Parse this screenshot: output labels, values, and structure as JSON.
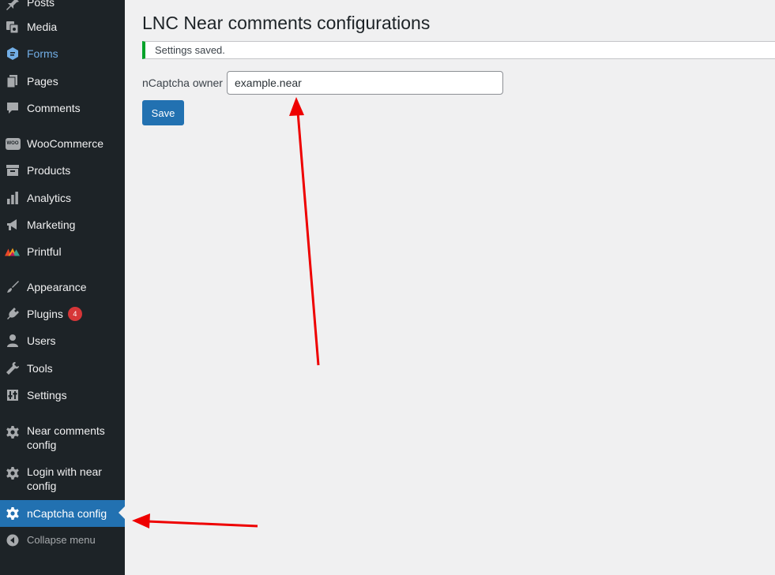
{
  "sidebar": {
    "items": [
      {
        "label": "Posts",
        "icon": "pin-icon"
      },
      {
        "label": "Media",
        "icon": "media-icon"
      },
      {
        "label": "Forms",
        "icon": "forms-icon"
      },
      {
        "label": "Pages",
        "icon": "pages-icon"
      },
      {
        "label": "Comments",
        "icon": "comment-icon"
      },
      {
        "label": "WooCommerce",
        "icon": "woocommerce-icon",
        "icon_text": "WOO"
      },
      {
        "label": "Products",
        "icon": "archive-icon"
      },
      {
        "label": "Analytics",
        "icon": "bar-chart-icon"
      },
      {
        "label": "Marketing",
        "icon": "megaphone-icon"
      },
      {
        "label": "Printful",
        "icon": "printful-logo-icon"
      },
      {
        "label": "Appearance",
        "icon": "brush-icon"
      },
      {
        "label": "Plugins",
        "icon": "plugin-icon",
        "badge": "4"
      },
      {
        "label": "Users",
        "icon": "user-icon"
      },
      {
        "label": "Tools",
        "icon": "wrench-icon"
      },
      {
        "label": "Settings",
        "icon": "settings-icon"
      },
      {
        "label": "Near comments config",
        "icon": "gear-icon"
      },
      {
        "label": "Login with near config",
        "icon": "gear-icon"
      },
      {
        "label": "nCaptcha config",
        "icon": "gear-icon",
        "current": true
      },
      {
        "label": "Collapse menu",
        "icon": "collapse-icon"
      }
    ]
  },
  "main": {
    "title": "LNC Near comments configurations",
    "notice": "Settings saved.",
    "owner_label": "nCaptcha owner",
    "owner_value": "example.near",
    "save_label": "Save"
  },
  "colors": {
    "sidebar_bg": "#1d2327",
    "accent": "#2271b1",
    "forms_blue": "#72aee6",
    "notice_green": "#00a32a",
    "badge_red": "#d63638",
    "annotation_red": "#ee0000"
  }
}
